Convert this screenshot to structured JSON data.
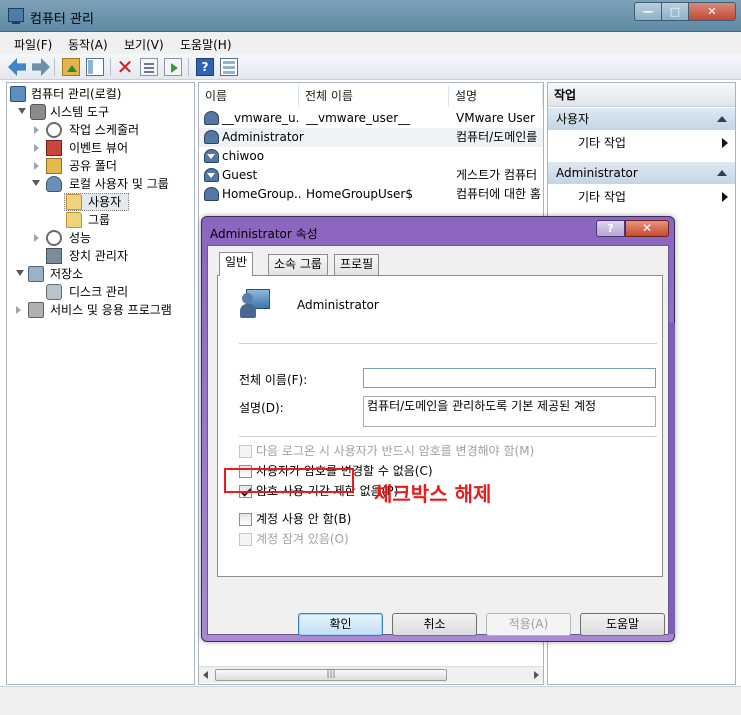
{
  "window": {
    "title": "컴퓨터 관리",
    "controls": {
      "minimize": "—",
      "maximize": "□",
      "close": "✕"
    }
  },
  "menu": [
    "파일(F)",
    "동작(A)",
    "보기(V)",
    "도움말(H)"
  ],
  "toolbar": {
    "delete_glyph": "✕",
    "help_glyph": "?"
  },
  "tree": [
    {
      "label": "컴퓨터 관리(로컬)",
      "icon": "computer-icon",
      "level": 0,
      "expanded": true
    },
    {
      "label": "시스템 도구",
      "icon": "tools-icon",
      "level": 1,
      "expanded": true
    },
    {
      "label": "작업 스케줄러",
      "icon": "clock-icon",
      "level": 2,
      "expanded": false
    },
    {
      "label": "이벤트 뷰어",
      "icon": "event-icon",
      "level": 2,
      "expanded": false
    },
    {
      "label": "공유 폴더",
      "icon": "share-icon",
      "level": 2,
      "expanded": false
    },
    {
      "label": "로컬 사용자 및 그룹",
      "icon": "users-icon",
      "level": 2,
      "expanded": true
    },
    {
      "label": "사용자",
      "icon": "folder-icon",
      "level": 3,
      "selected": true
    },
    {
      "label": "그룹",
      "icon": "folder-icon",
      "level": 3
    },
    {
      "label": "성능",
      "icon": "perf-icon",
      "level": 2,
      "expanded": false
    },
    {
      "label": "장치 관리자",
      "icon": "device-icon",
      "level": 2
    },
    {
      "label": "저장소",
      "icon": "storage-icon",
      "level": 1,
      "expanded": true
    },
    {
      "label": "디스크 관리",
      "icon": "disk-icon",
      "level": 2
    },
    {
      "label": "서비스 및 응용 프로그램",
      "icon": "services-icon",
      "level": 1,
      "expanded": false
    }
  ],
  "list": {
    "columns": [
      "이름",
      "전체 이름",
      "설명"
    ],
    "rows": [
      {
        "name": "__vmware_u...",
        "fullname": "__vmware_user__",
        "desc": "VMware User",
        "disabled": false
      },
      {
        "name": "Administrator",
        "fullname": "",
        "desc": "컴퓨터/도메인를",
        "disabled": false
      },
      {
        "name": "chiwoo",
        "fullname": "",
        "desc": "",
        "disabled": true
      },
      {
        "name": "Guest",
        "fullname": "",
        "desc": "게스트가 컴퓨터",
        "disabled": true
      },
      {
        "name": "HomeGroup...",
        "fullname": "HomeGroupUser$",
        "desc": "컴퓨터에 대한 홈",
        "disabled": false
      }
    ],
    "hscroll_grip": "|||"
  },
  "actions": {
    "title": "작업",
    "groups": [
      {
        "label": "사용자",
        "items": [
          "기타 작업"
        ]
      },
      {
        "label": "Administrator",
        "items": [
          "기타 작업"
        ]
      }
    ]
  },
  "dialog": {
    "title": "Administrator 속성",
    "help_glyph": "?",
    "close_glyph": "✕",
    "tabs": [
      "일반",
      "소속 그룹",
      "프로필"
    ],
    "active_tab": 0,
    "username": "Administrator",
    "fullname_label": "전체 이름(F):",
    "fullname_value": "",
    "desc_label": "설명(D):",
    "desc_value": "컴퓨터/도메인을 관리하도록 기본 제공된 계정",
    "checkboxes": [
      {
        "label": "다음 로그온 시 사용자가 반드시 암호를 변경해야 함(M)",
        "checked": false,
        "enabled": false
      },
      {
        "label": "사용자가 암호를 변경할 수 없음(C)",
        "checked": false,
        "enabled": true
      },
      {
        "label": "암호 사용 기간 제한 없음(P)",
        "checked": true,
        "enabled": true
      },
      {
        "label": "계정 사용 안 함(B)",
        "checked": false,
        "enabled": true
      },
      {
        "label": "계정 잠겨 있음(O)",
        "checked": false,
        "enabled": false
      }
    ],
    "annotation": "체크박스 해제",
    "buttons": {
      "ok": "확인",
      "cancel": "취소",
      "apply": "적용(A)",
      "help": "도움말"
    }
  },
  "colors": {
    "annotation": "#e81c1c",
    "dialog_frame": "#8c65bf"
  }
}
